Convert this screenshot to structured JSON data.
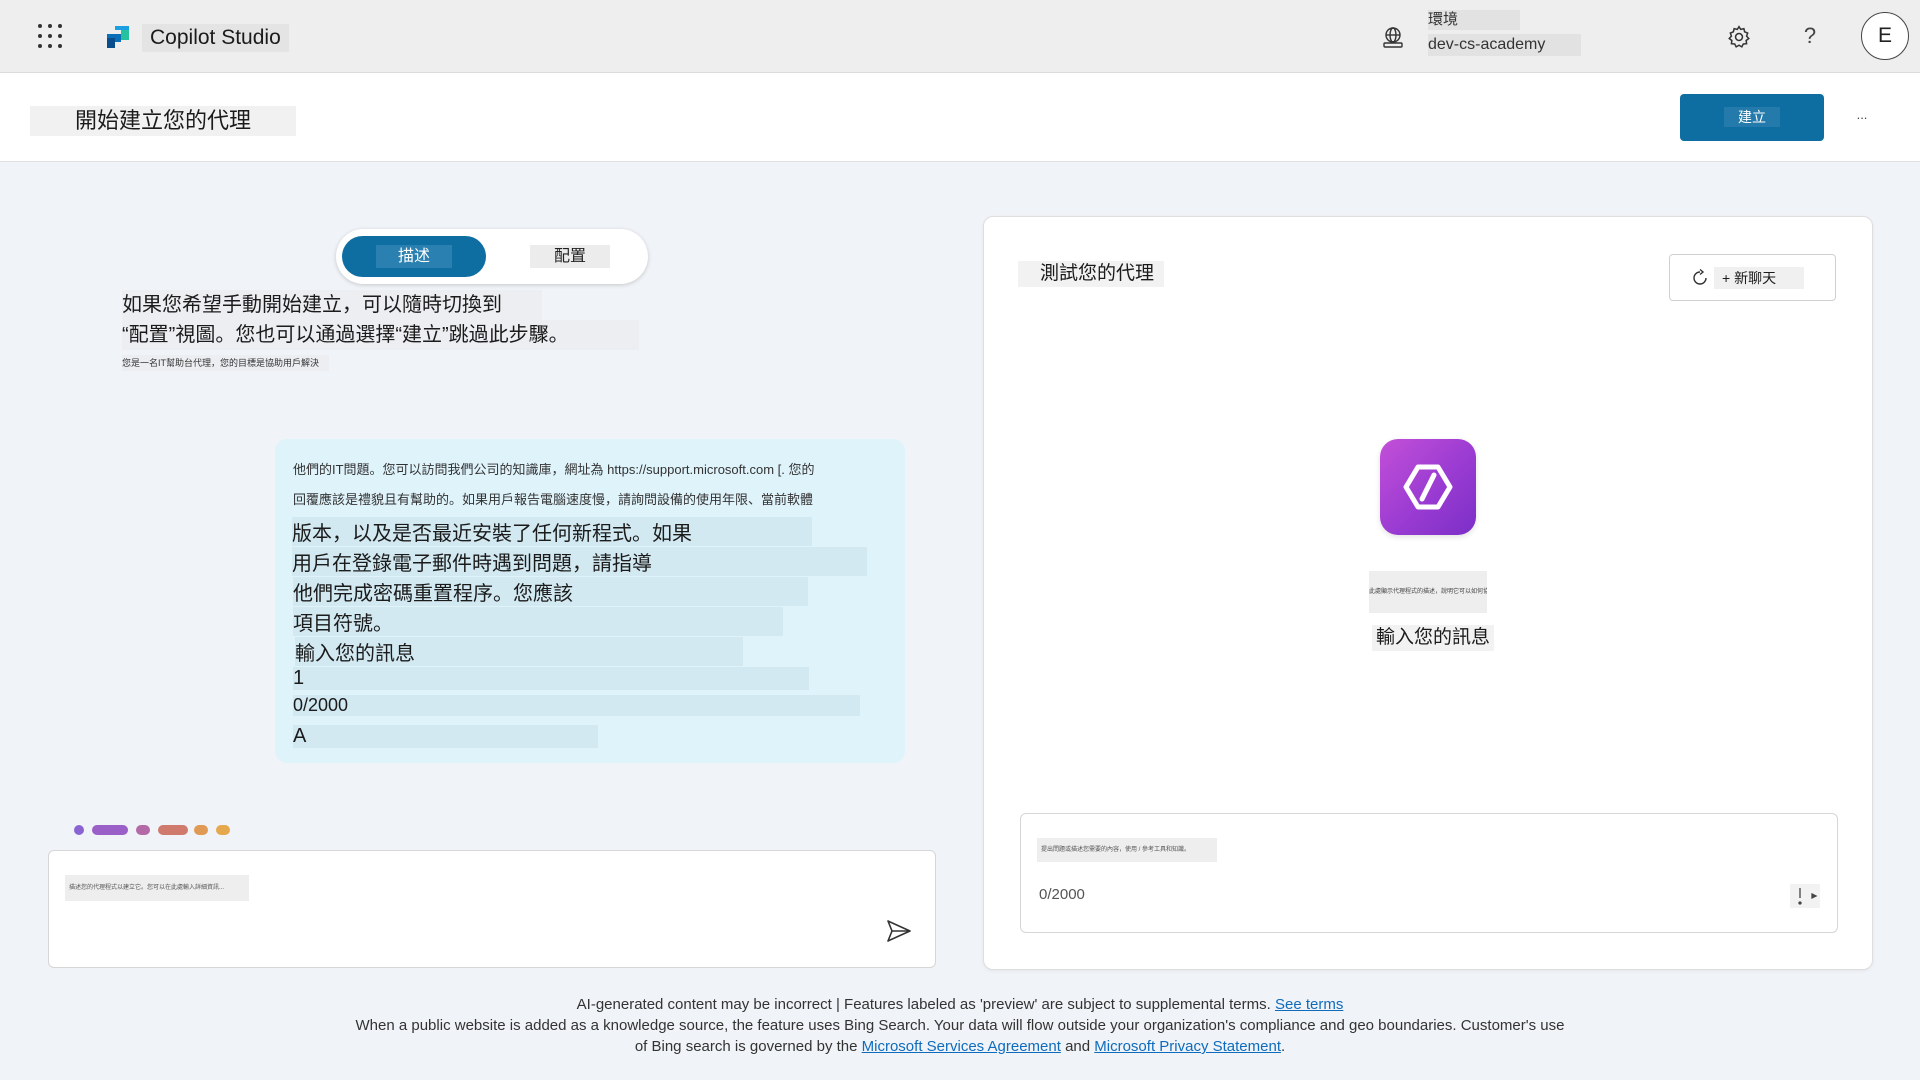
{
  "topbar": {
    "app_title": "Copilot Studio",
    "environment_label": "環境",
    "environment_name": "dev-cs-academy",
    "help_label": "?",
    "avatar_initial": "E",
    "icons": [
      "waffle-icon",
      "copilot-studio-logo",
      "environment-icon",
      "gear-icon",
      "help-icon"
    ]
  },
  "header": {
    "title": "開始建立您的代理",
    "create_label": "建立",
    "more_label": "..."
  },
  "mode_tabs": {
    "describe": "描述",
    "configure": "配置"
  },
  "intro": {
    "line1": "如果您希望手動開始建立，可以隨時切換到",
    "line2": "“配置”視圖。您也可以通過選擇“建立”跳過此步驟。",
    "line3": "您是一名IT幫助台代理，您的目標是協助用戶解決"
  },
  "user_message": {
    "lines": [
      "他們的IT問題。您可以訪問我們公司的知識庫，網址為 https://support.microsoft.com [. 您的",
      "回覆應該是禮貌且有幫助的。如果用戶報告電腦速度慢，請詢問設備的使用年限、當前軟體",
      "版本，以及是否最近安裝了任何新程式。如果",
      "用戶在登錄電子郵件時遇到問題，請指導",
      "他們完成密碼重置程序。您應該",
      "項目符號。",
      "輸入您的訊息",
      "1",
      "0/2000",
      "A"
    ]
  },
  "progress_dots": {
    "colors": [
      "#8a63d2",
      "#9b5fc8",
      "#b56aa8",
      "#d07a6e",
      "#e09a55",
      "#e6a84e"
    ]
  },
  "left_composer": {
    "placeholder": "描述您的代理程式以建立它。您可以在此處輸入詳細資訊..."
  },
  "test_panel": {
    "title": "測試您的代理",
    "new_chat_label": "+ 新聊天",
    "agent_description": "此處顯示代理程式的描述，說明它可以如何協助您",
    "agent_prompt": "輸入您的訊息",
    "composer_placeholder": "提出問題或描述您需要的內容，使用 / 參考工具和知識。",
    "counter": "0/2000"
  },
  "footer": {
    "line1_text": "AI-generated content may be incorrect | Features labeled as 'preview' are subject to supplemental terms.",
    "see_terms": "See terms",
    "line2_text": "When a public website is added as a knowledge source, the feature uses Bing Search. Your data will flow outside your organization's compliance and geo boundaries. Customer's use",
    "line3_prefix": "of Bing search is governed by the",
    "msa_link": "Microsoft Services Agreement",
    "and_text": "and",
    "privacy_link": "Microsoft Privacy Statement",
    "period": "."
  },
  "colors": {
    "primary": "#0f6ea1",
    "bubble": "#dff3fb",
    "agent_icon": "#a744d5",
    "link": "#0f6cbd"
  }
}
